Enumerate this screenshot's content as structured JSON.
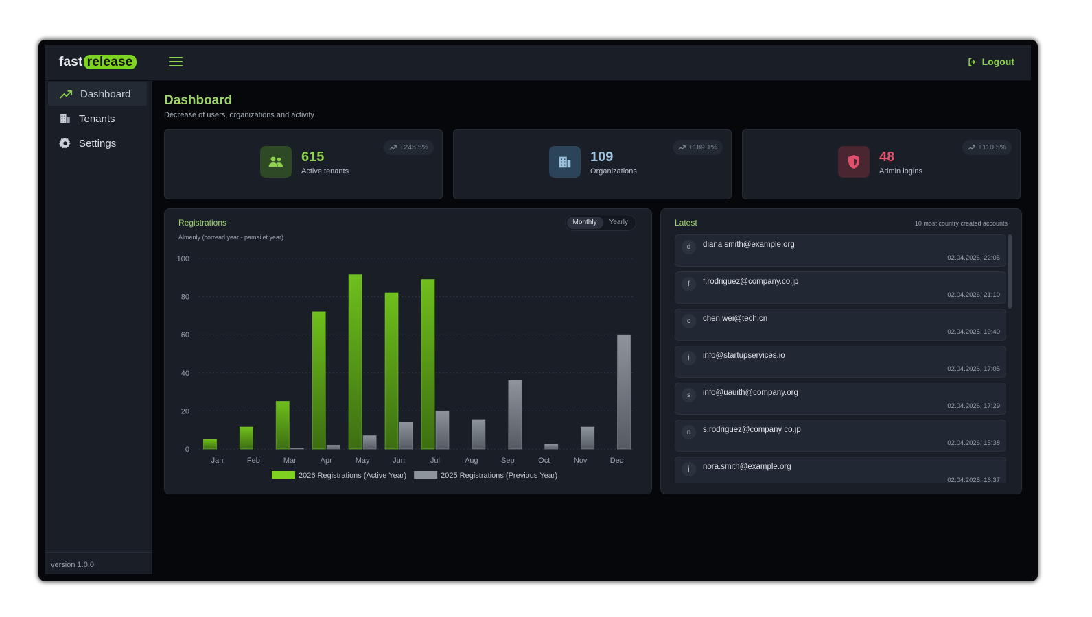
{
  "app": {
    "logo_prefix": "fast",
    "logo_highlight": "release",
    "logout_label": "Logout",
    "version": "version 1.0.0"
  },
  "sidebar": {
    "items": [
      {
        "label": "Dashboard",
        "icon": "trend-chart-icon",
        "active": true
      },
      {
        "label": "Tenants",
        "icon": "building-icon",
        "active": false
      },
      {
        "label": "Settings",
        "icon": "gear-icon",
        "active": false
      }
    ]
  },
  "page": {
    "title": "Dashboard",
    "subtitle": "Decrease of users, organizations and activity"
  },
  "stats": [
    {
      "value": "615",
      "label": "Active tenants",
      "trend": "+245.5%",
      "icon": "users-icon",
      "color": "#8fd14f",
      "icon_bg": "#2d4a25"
    },
    {
      "value": "109",
      "label": "Organizations",
      "trend": "+189.1%",
      "icon": "building-icon",
      "color": "#9fc3df",
      "icon_bg": "#2c4459"
    },
    {
      "value": "48",
      "label": "Admin logins",
      "trend": "+110.5%",
      "icon": "shield-icon",
      "color": "#e0506c",
      "icon_bg": "#4a2630"
    }
  ],
  "registrations": {
    "title": "Registrations",
    "subtitle": "Almenly (corread year - pamaiiet year)",
    "toggle": {
      "monthly": "Monthly",
      "yearly": "Yearly",
      "selected": "Monthly"
    }
  },
  "chart_data": {
    "type": "bar",
    "categories": [
      "Jan",
      "Feb",
      "Mar",
      "Apr",
      "May",
      "Jun",
      "Jul",
      "Aug",
      "Sep",
      "Oct",
      "Nov",
      "Dec"
    ],
    "series": [
      {
        "name": "2026 Registrations (Active Year)",
        "color": "#7ed321",
        "values": [
          5,
          11.5,
          25,
          72,
          91.5,
          82,
          89,
          null,
          null,
          null,
          null,
          null
        ]
      },
      {
        "name": "2025 Registrations (Previous Year)",
        "color": "#8e949c",
        "values": [
          0,
          0,
          0.5,
          2,
          7,
          14,
          20,
          15.5,
          36,
          2.5,
          11.5,
          60
        ]
      }
    ],
    "yticks": [
      0,
      20,
      40,
      60,
      80,
      100
    ],
    "ylim": [
      0,
      100
    ],
    "grid": true,
    "legend": "bottom"
  },
  "latest": {
    "title": "Latest",
    "note": "10 most country created accounts",
    "items": [
      {
        "initial": "d",
        "email": "diana smith@example.org",
        "time": "02.04.2026, 22:05"
      },
      {
        "initial": "f",
        "email": "f.rodriguez@company.co.jp",
        "time": "02.04.2026, 21:10"
      },
      {
        "initial": "c",
        "email": "chen.wei@tech.cn",
        "time": "02.04.2025, 19:40"
      },
      {
        "initial": "i",
        "email": "info@startupservices.io",
        "time": "02.04.2026, 17:05"
      },
      {
        "initial": "s",
        "email": "info@uauith@company.org",
        "time": "02.04.2026, 17:29"
      },
      {
        "initial": "n",
        "email": "s.rodriguez@company co.jp",
        "time": "02.04.2026, 15:38"
      },
      {
        "initial": "j",
        "email": "nora.smith@example.org",
        "time": "02.04.2025, 16:37"
      }
    ]
  }
}
